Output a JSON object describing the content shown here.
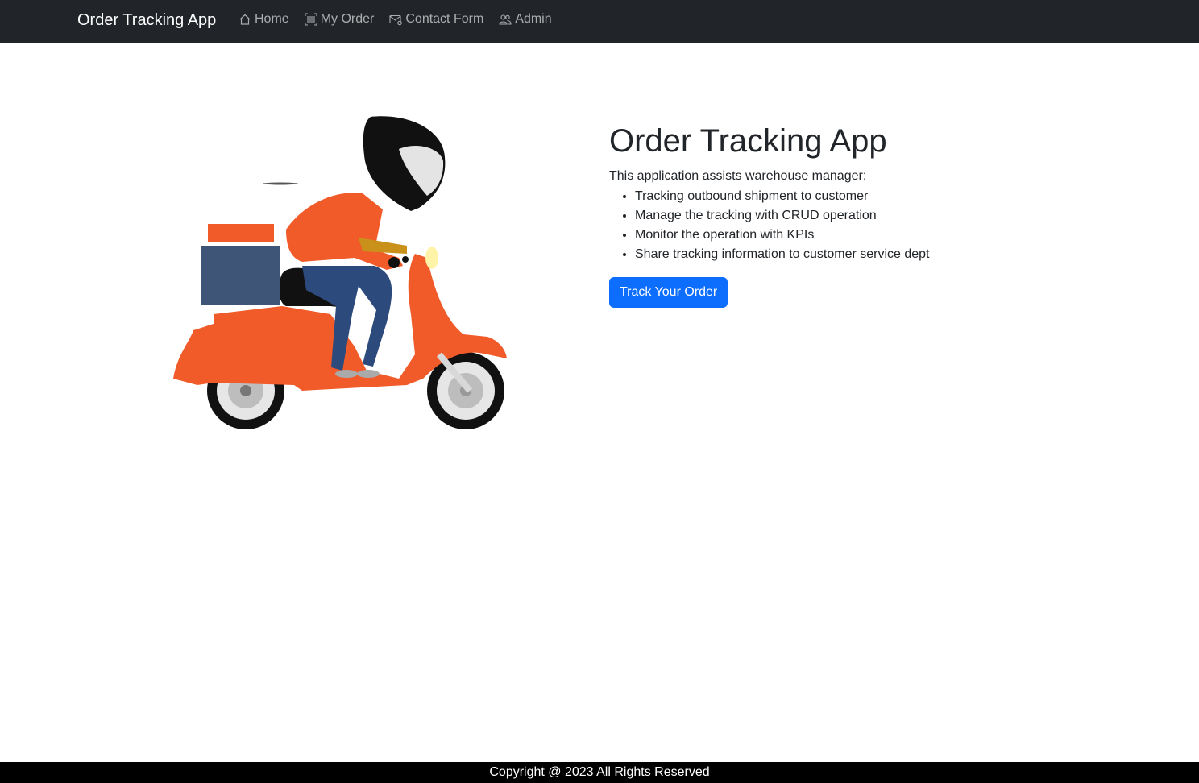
{
  "navbar": {
    "brand": "Order Tracking App",
    "links": [
      {
        "label": "Home",
        "icon": "home-icon"
      },
      {
        "label": "My Order",
        "icon": "barcode-icon"
      },
      {
        "label": "Contact Form",
        "icon": "envelope-icon"
      },
      {
        "label": "Admin",
        "icon": "people-icon"
      }
    ]
  },
  "hero": {
    "title": "Order Tracking App",
    "intro": "This application assists warehouse manager:",
    "features": [
      "Tracking outbound shipment to customer",
      "Manage the tracking with CRUD operation",
      "Monitor the operation with KPIs",
      "Share tracking information to customer service dept"
    ],
    "button_label": "Track Your Order",
    "button_color": "#0d6efd",
    "illustration": "delivery-scooter-illustration"
  },
  "footer": {
    "text": "Copyright @ 2023 All Rights Reserved"
  },
  "colors": {
    "navbar": "#212529",
    "scooter": "#f15a29",
    "box": "#3e5577"
  }
}
